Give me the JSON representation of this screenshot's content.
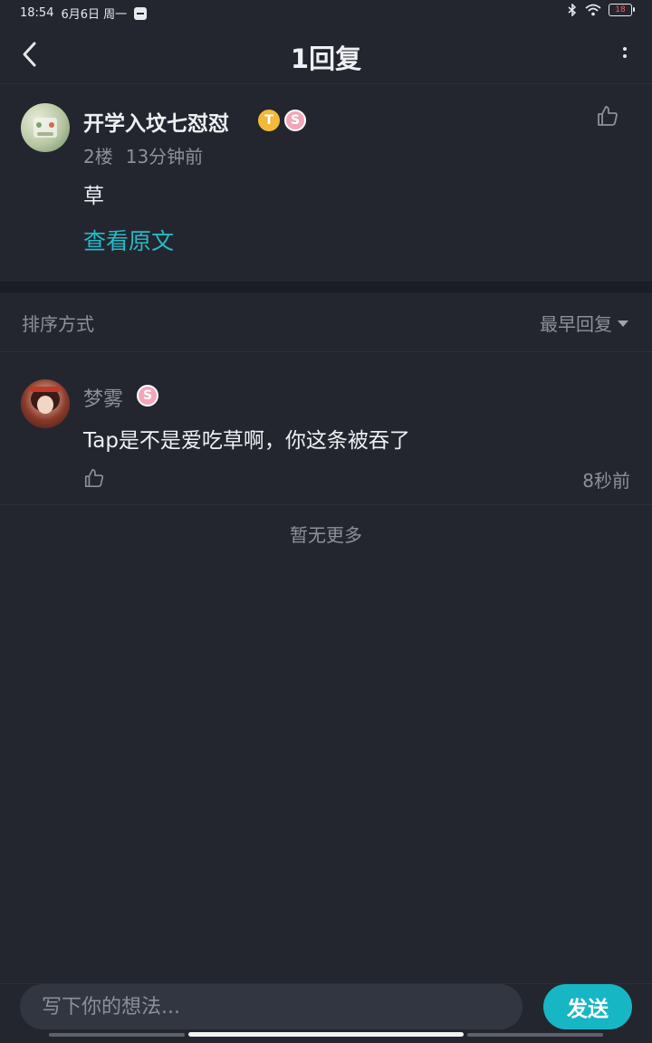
{
  "status_bar": {
    "time": "18:54",
    "date": "6月6日 周一",
    "battery": "18"
  },
  "nav": {
    "title": "1回复"
  },
  "main_post": {
    "username": "开学入坟七怼怼",
    "badge_gold": "T",
    "badge_pink": "S",
    "floor": "2楼",
    "time": "13分钟前",
    "content": "草",
    "view_original": "查看原文"
  },
  "sort": {
    "label": "排序方式",
    "selected": "最早回复"
  },
  "replies": [
    {
      "username": "梦雾",
      "badge": "S",
      "content": "Tap是不是爱吃草啊，你这条被吞了",
      "time": "8秒前"
    }
  ],
  "no_more": "暂无更多",
  "composer": {
    "placeholder": "写下你的想法...",
    "send_label": "发送"
  },
  "colors": {
    "background": "#23262f",
    "accent": "#17b6c4",
    "link": "#26b9c8"
  }
}
